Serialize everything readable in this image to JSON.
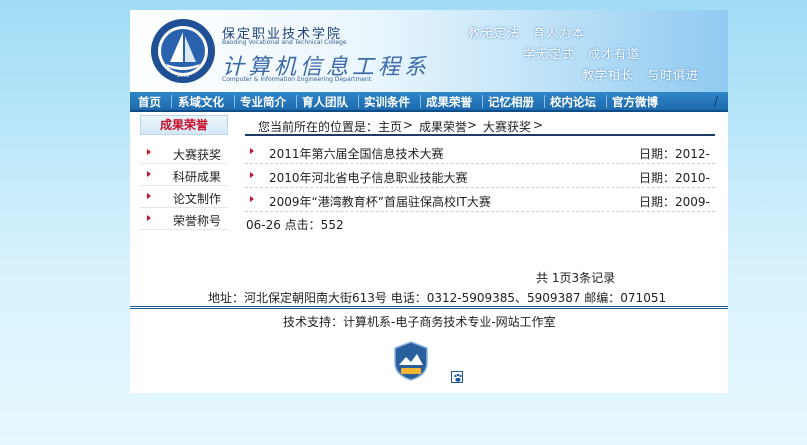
{
  "header": {
    "school_cn": "保定职业技术学院",
    "school_en": "Baoding Vocational and Technical College",
    "dept_cn": "计算机信息工程系",
    "dept_en": "Computer & Information Engineering Department",
    "motto": [
      "教无定法　育人为本",
      "学无定式　成才有道",
      "教学相长　与时俱进"
    ]
  },
  "nav": {
    "items": [
      "首页",
      "系域文化",
      "专业简介",
      "育人团队",
      "实训条件",
      "成果荣誉",
      "记忆相册",
      "校内论坛",
      "官方微博"
    ],
    "trailing": "/"
  },
  "sidebar": {
    "title": "成果荣誉",
    "items": [
      "大赛获奖",
      "科研成果",
      "论文制作",
      "荣誉称号"
    ]
  },
  "breadcrumb": {
    "prefix": "您当前所在的位置是：",
    "home": "主页",
    "sep1": " > ",
    "section": "成果荣誉",
    "sep2": " > ",
    "current": "大赛获奖",
    "sep3": " >"
  },
  "list": [
    {
      "title": "2011年第六届全国信息技术大赛",
      "date": "日期：2012-"
    },
    {
      "title": "2010年河北省电子信息职业技能大赛",
      "date": "日期：2010-"
    },
    {
      "title": "2009年“港湾教育杯”首届驻保高校IT大赛",
      "date": "日期：2009-"
    }
  ],
  "overflow_text": "06-26 点击：552",
  "pager": "共 1页3条记录",
  "footer": {
    "address": "地址：河北保定朝阳南大街613号 电话：0312-5909385、5909387 邮编：071051",
    "tech_support": "技术支持：计算机系-电子商务技术专业-网站工作室"
  },
  "icons": {
    "logo": "college-seal-icon",
    "badge": "site-badge-icon",
    "stat": "paw-stat-icon"
  },
  "colors": {
    "nav_bg": "#1e6aad",
    "accent_red": "#c8102e",
    "rule": "#1e3d66"
  }
}
